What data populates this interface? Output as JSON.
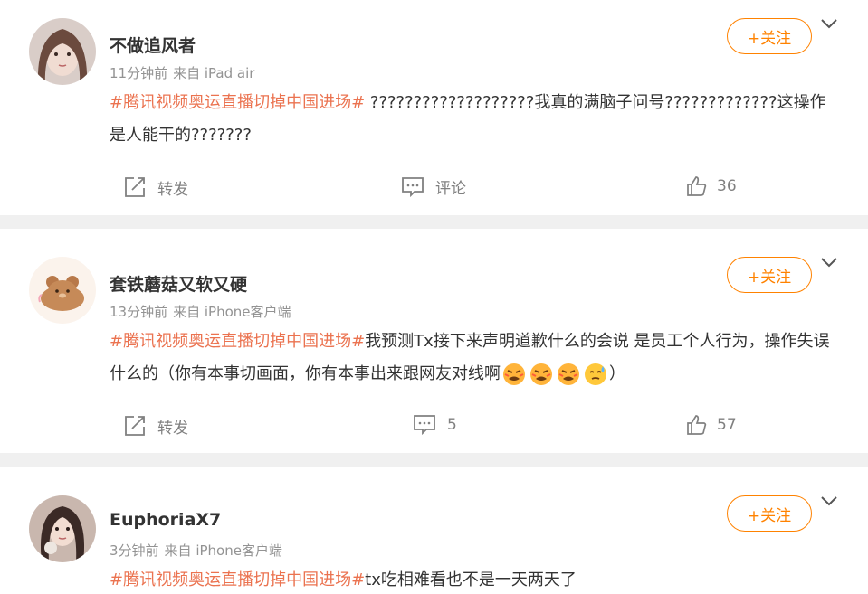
{
  "posts": [
    {
      "username": "不做追风者",
      "time": "11分钟前",
      "source": "来自 iPad air",
      "follow_label": "+关注",
      "hashtag": "#腾讯视频奥运直播切掉中国进场#",
      "text": " ???????????????????我真的满脑子问号?????????????这操作是人能干的???????",
      "repost_label": "转发",
      "comment_label": "评论",
      "like_count": "36"
    },
    {
      "username": "套铁蘑菇又软又硬",
      "time": "13分钟前",
      "source": "来自 iPhone客户端",
      "follow_label": "+关注",
      "hashtag": "#腾讯视频奥运直播切掉中国进场#",
      "text": "我预测Tx接下来声明道歉什么的会说 是员工个人行为，操作失误什么的（你有本事切画面，你有本事出来跟网友对线啊",
      "text_end": "）",
      "emojis": [
        "angry-face-icon",
        "angry-face-icon",
        "angry-face-icon",
        "sweat-face-icon"
      ],
      "repost_label": "转发",
      "comment_count": "5",
      "like_count": "57"
    },
    {
      "username": "EuphoriaX7",
      "time": "3分钟前",
      "source": "来自 iPhone客户端",
      "follow_label": "+关注",
      "hashtag": "#腾讯视频奥运直播切掉中国进场#",
      "text": "tx吃相难看也不是一天两天了"
    }
  ],
  "colors": {
    "accent": "#ff8200",
    "hashtag": "#eb7350",
    "meta": "#939393",
    "action": "#808080",
    "background": "#f0f0f0"
  }
}
